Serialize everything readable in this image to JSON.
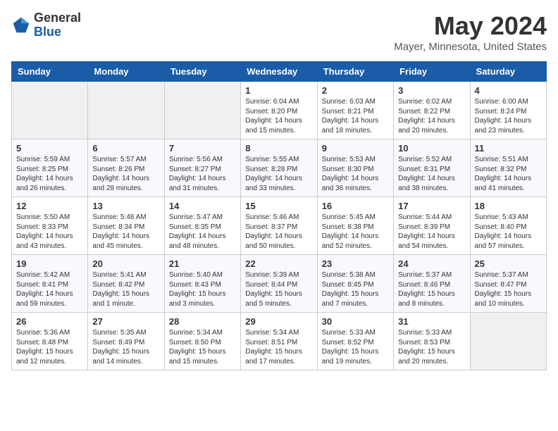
{
  "header": {
    "logo_general": "General",
    "logo_blue": "Blue",
    "month_year": "May 2024",
    "location": "Mayer, Minnesota, United States"
  },
  "days_of_week": [
    "Sunday",
    "Monday",
    "Tuesday",
    "Wednesday",
    "Thursday",
    "Friday",
    "Saturday"
  ],
  "weeks": [
    [
      {
        "day": "",
        "info": ""
      },
      {
        "day": "",
        "info": ""
      },
      {
        "day": "",
        "info": ""
      },
      {
        "day": "1",
        "info": "Sunrise: 6:04 AM\nSunset: 8:20 PM\nDaylight: 14 hours\nand 15 minutes."
      },
      {
        "day": "2",
        "info": "Sunrise: 6:03 AM\nSunset: 8:21 PM\nDaylight: 14 hours\nand 18 minutes."
      },
      {
        "day": "3",
        "info": "Sunrise: 6:02 AM\nSunset: 8:22 PM\nDaylight: 14 hours\nand 20 minutes."
      },
      {
        "day": "4",
        "info": "Sunrise: 6:00 AM\nSunset: 8:24 PM\nDaylight: 14 hours\nand 23 minutes."
      }
    ],
    [
      {
        "day": "5",
        "info": "Sunrise: 5:59 AM\nSunset: 8:25 PM\nDaylight: 14 hours\nand 26 minutes."
      },
      {
        "day": "6",
        "info": "Sunrise: 5:57 AM\nSunset: 8:26 PM\nDaylight: 14 hours\nand 28 minutes."
      },
      {
        "day": "7",
        "info": "Sunrise: 5:56 AM\nSunset: 8:27 PM\nDaylight: 14 hours\nand 31 minutes."
      },
      {
        "day": "8",
        "info": "Sunrise: 5:55 AM\nSunset: 8:28 PM\nDaylight: 14 hours\nand 33 minutes."
      },
      {
        "day": "9",
        "info": "Sunrise: 5:53 AM\nSunset: 8:30 PM\nDaylight: 14 hours\nand 36 minutes."
      },
      {
        "day": "10",
        "info": "Sunrise: 5:52 AM\nSunset: 8:31 PM\nDaylight: 14 hours\nand 38 minutes."
      },
      {
        "day": "11",
        "info": "Sunrise: 5:51 AM\nSunset: 8:32 PM\nDaylight: 14 hours\nand 41 minutes."
      }
    ],
    [
      {
        "day": "12",
        "info": "Sunrise: 5:50 AM\nSunset: 8:33 PM\nDaylight: 14 hours\nand 43 minutes."
      },
      {
        "day": "13",
        "info": "Sunrise: 5:48 AM\nSunset: 8:34 PM\nDaylight: 14 hours\nand 45 minutes."
      },
      {
        "day": "14",
        "info": "Sunrise: 5:47 AM\nSunset: 8:35 PM\nDaylight: 14 hours\nand 48 minutes."
      },
      {
        "day": "15",
        "info": "Sunrise: 5:46 AM\nSunset: 8:37 PM\nDaylight: 14 hours\nand 50 minutes."
      },
      {
        "day": "16",
        "info": "Sunrise: 5:45 AM\nSunset: 8:38 PM\nDaylight: 14 hours\nand 52 minutes."
      },
      {
        "day": "17",
        "info": "Sunrise: 5:44 AM\nSunset: 8:39 PM\nDaylight: 14 hours\nand 54 minutes."
      },
      {
        "day": "18",
        "info": "Sunrise: 5:43 AM\nSunset: 8:40 PM\nDaylight: 14 hours\nand 57 minutes."
      }
    ],
    [
      {
        "day": "19",
        "info": "Sunrise: 5:42 AM\nSunset: 8:41 PM\nDaylight: 14 hours\nand 59 minutes."
      },
      {
        "day": "20",
        "info": "Sunrise: 5:41 AM\nSunset: 8:42 PM\nDaylight: 15 hours\nand 1 minute."
      },
      {
        "day": "21",
        "info": "Sunrise: 5:40 AM\nSunset: 8:43 PM\nDaylight: 15 hours\nand 3 minutes."
      },
      {
        "day": "22",
        "info": "Sunrise: 5:39 AM\nSunset: 8:44 PM\nDaylight: 15 hours\nand 5 minutes."
      },
      {
        "day": "23",
        "info": "Sunrise: 5:38 AM\nSunset: 8:45 PM\nDaylight: 15 hours\nand 7 minutes."
      },
      {
        "day": "24",
        "info": "Sunrise: 5:37 AM\nSunset: 8:46 PM\nDaylight: 15 hours\nand 8 minutes."
      },
      {
        "day": "25",
        "info": "Sunrise: 5:37 AM\nSunset: 8:47 PM\nDaylight: 15 hours\nand 10 minutes."
      }
    ],
    [
      {
        "day": "26",
        "info": "Sunrise: 5:36 AM\nSunset: 8:48 PM\nDaylight: 15 hours\nand 12 minutes."
      },
      {
        "day": "27",
        "info": "Sunrise: 5:35 AM\nSunset: 8:49 PM\nDaylight: 15 hours\nand 14 minutes."
      },
      {
        "day": "28",
        "info": "Sunrise: 5:34 AM\nSunset: 8:50 PM\nDaylight: 15 hours\nand 15 minutes."
      },
      {
        "day": "29",
        "info": "Sunrise: 5:34 AM\nSunset: 8:51 PM\nDaylight: 15 hours\nand 17 minutes."
      },
      {
        "day": "30",
        "info": "Sunrise: 5:33 AM\nSunset: 8:52 PM\nDaylight: 15 hours\nand 19 minutes."
      },
      {
        "day": "31",
        "info": "Sunrise: 5:33 AM\nSunset: 8:53 PM\nDaylight: 15 hours\nand 20 minutes."
      },
      {
        "day": "",
        "info": ""
      }
    ]
  ]
}
